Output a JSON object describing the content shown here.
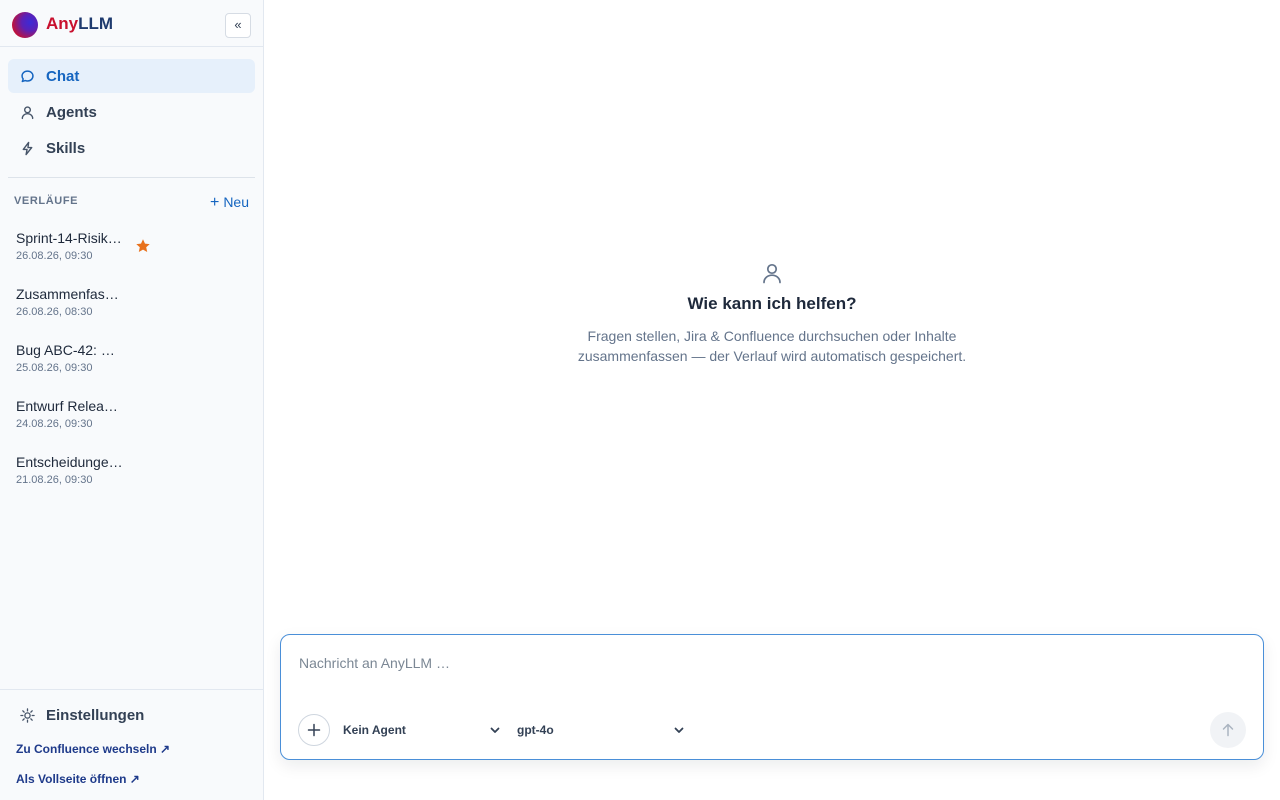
{
  "brand": {
    "name_part1": "Any",
    "name_part2": "LLM",
    "collapse_label": "«"
  },
  "nav": {
    "items": [
      {
        "label": "Chat",
        "icon": "chat-bubble-icon",
        "active": true
      },
      {
        "label": "Agents",
        "icon": "user-icon",
        "active": false
      },
      {
        "label": "Skills",
        "icon": "lightning-icon",
        "active": false
      }
    ]
  },
  "history": {
    "title": "VERLÄUFE",
    "new_label": "Neu",
    "items": [
      {
        "title": "Sprint-14-Risik…",
        "date": "26.08.26, 09:30",
        "starred": true
      },
      {
        "title": "Zusammenfas…",
        "date": "26.08.26, 08:30",
        "starred": false
      },
      {
        "title": "Bug ABC-42: …",
        "date": "25.08.26, 09:30",
        "starred": false
      },
      {
        "title": "Entwurf Relea…",
        "date": "24.08.26, 09:30",
        "starred": false
      },
      {
        "title": "Entscheidunge…",
        "date": "21.08.26, 09:30",
        "starred": false
      }
    ]
  },
  "footer": {
    "settings_label": "Einstellungen",
    "link_confluence": "Zu Confluence wechseln ↗",
    "link_fullpage": "Als Vollseite öffnen ↗"
  },
  "empty_state": {
    "title": "Wie kann ich helfen?",
    "description": "Fragen stellen, Jira & Confluence durchsuchen oder Inhalte zusammenfassen — der Verlauf wird automatisch gespeichert."
  },
  "composer": {
    "placeholder": "Nachricht an AnyLLM …",
    "value": "",
    "agent_select": "Kein Agent",
    "model_select": "gpt-4o"
  },
  "colors": {
    "accent": "#1565c0",
    "active_bg": "#e6f0fb",
    "star": "#e8711c",
    "brand_red": "#c8102e",
    "brand_navy": "#1e3a6e"
  }
}
